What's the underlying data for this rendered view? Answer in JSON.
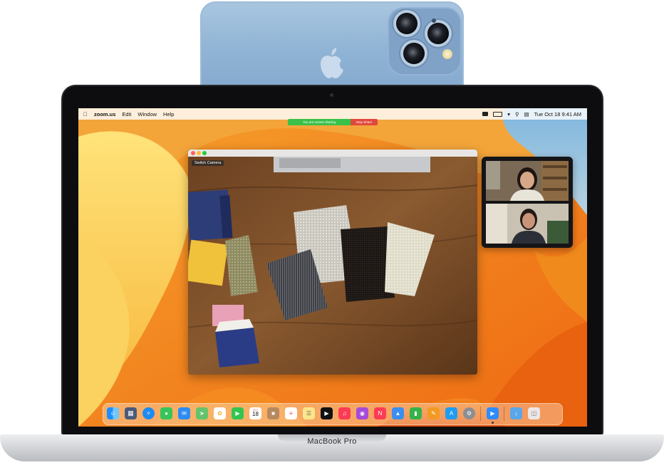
{
  "menubar": {
    "app": "zoom.us",
    "items": [
      "Edit",
      "Window",
      "Help"
    ],
    "datetime": "Tue Oct 18  9:41 AM"
  },
  "sharing": {
    "status": "You are screen sharing",
    "stop": "Stop Share"
  },
  "camera_window": {
    "switch_camera": "Switch Camera"
  },
  "laptop": {
    "brand": "MacBook Pro"
  },
  "calendar_icon": {
    "month": "OCT",
    "day": "18"
  },
  "dock": {
    "apps": [
      "Finder",
      "Launchpad",
      "Safari",
      "Messages",
      "Mail",
      "Maps",
      "Photos",
      "FaceTime",
      "Calendar",
      "Contacts",
      "Reminders",
      "Notes",
      "TV",
      "Music",
      "Podcasts",
      "News",
      "Keynote",
      "Numbers",
      "Pages",
      "App Store",
      "System Settings",
      "Zoom",
      "Downloads",
      "Trash"
    ]
  },
  "colors": {
    "share_green": "#39c14a",
    "share_red": "#e0483b",
    "wallpaper_orange": "#f0a13a",
    "iphone_blue": "#8fb3d4"
  }
}
